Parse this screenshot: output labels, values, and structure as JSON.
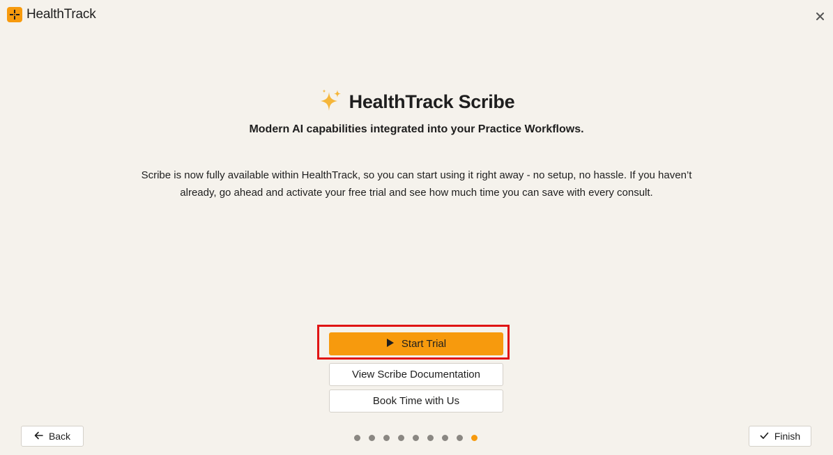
{
  "app": {
    "brand_name": "HealthTrack",
    "accent_color": "#f79a0d"
  },
  "hero": {
    "icon": "sparkles-icon",
    "title": "HealthTrack Scribe",
    "subtitle": "Modern AI capabilities integrated into your Practice Workflows.",
    "body": "Scribe is now fully available within HealthTrack, so you can start using it right away - no setup, no hassle. If you haven’t already, go ahead and activate your free trial and see how much time you can save with every consult."
  },
  "actions": {
    "start_trial": "Start Trial",
    "view_docs": "View Scribe Documentation",
    "book_time": "Book Time with Us"
  },
  "footer": {
    "back_label": "Back",
    "finish_label": "Finish",
    "steps_total": 9,
    "steps_active": 9
  }
}
